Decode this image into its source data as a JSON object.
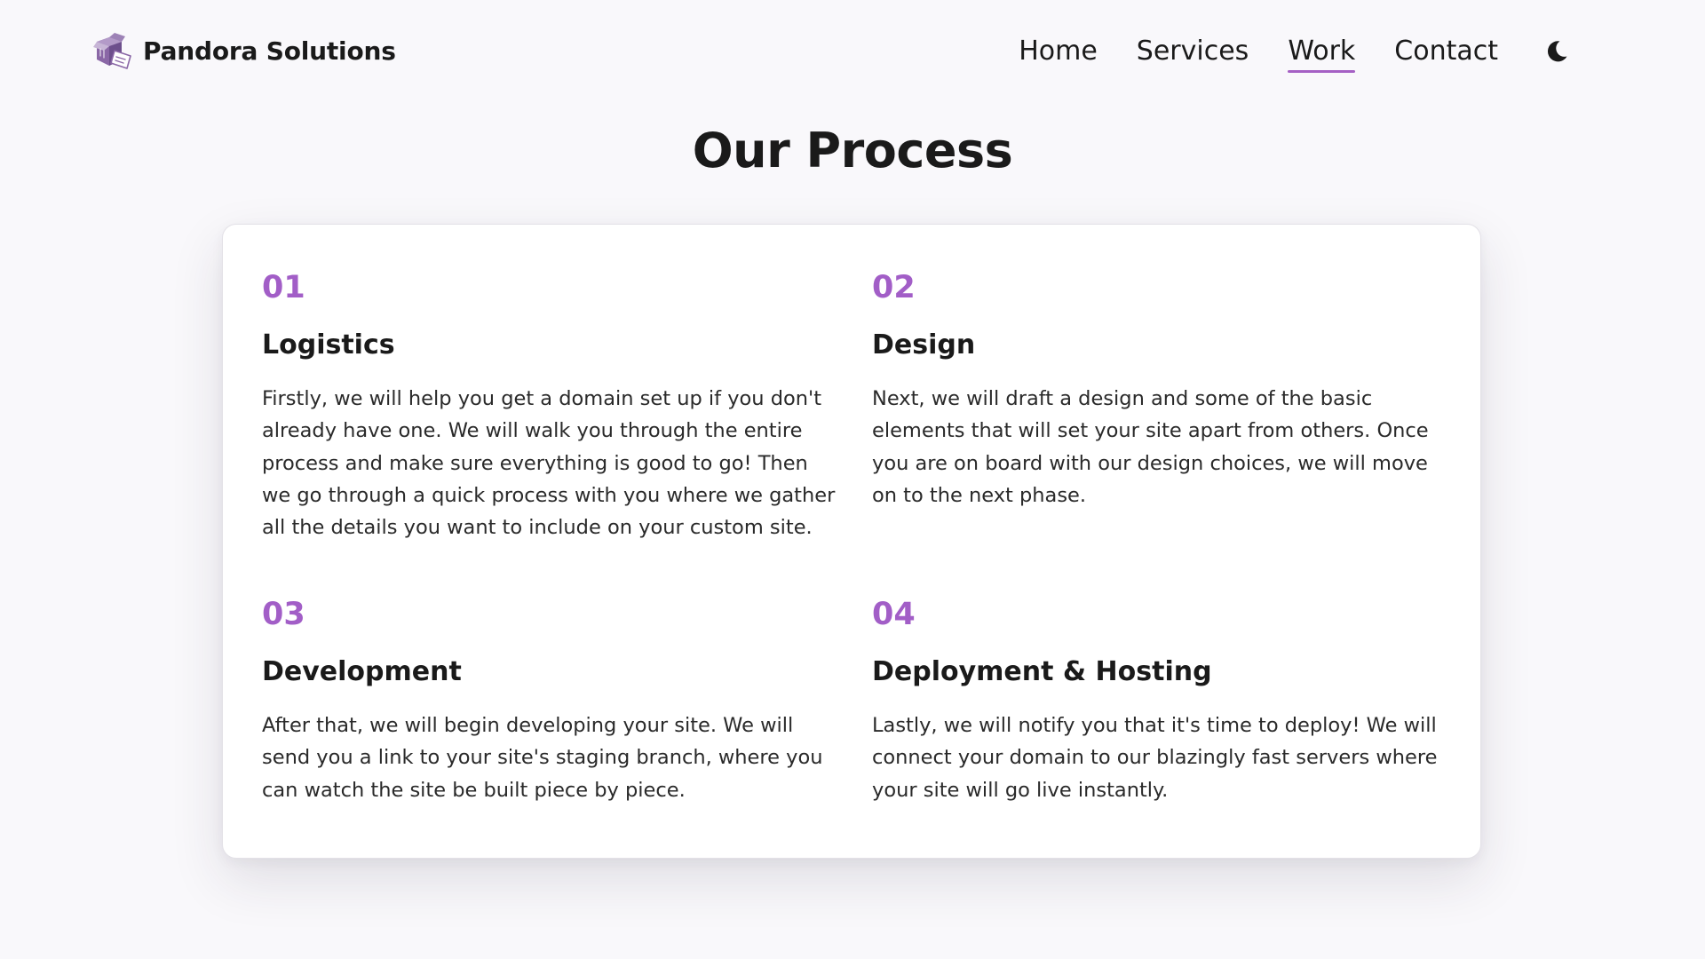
{
  "brand": {
    "name": "Pandora Solutions",
    "logo_icon": "open-box-logo-icon"
  },
  "nav": {
    "items": [
      {
        "label": "Home",
        "active": false
      },
      {
        "label": "Services",
        "active": false
      },
      {
        "label": "Work",
        "active": true
      },
      {
        "label": "Contact",
        "active": false
      }
    ],
    "theme_toggle_icon": "moon-icon"
  },
  "page": {
    "title": "Our Process"
  },
  "process": {
    "steps": [
      {
        "number": "01",
        "title": "Logistics",
        "description": "Firstly, we will help you get a domain set up if you don't already have one. We will walk you through the entire process and make sure everything is good to go! Then we go through a quick process with you where we gather all the details you want to include on your custom site."
      },
      {
        "number": "02",
        "title": "Design",
        "description": "Next, we will draft a design and some of the basic elements that will set your site apart from others. Once you are on board with our design choices, we will move on to the next phase."
      },
      {
        "number": "03",
        "title": "Development",
        "description": "After that, we will begin developing your site. We will send you a link to your site's staging branch, where you can watch the site be built piece by piece."
      },
      {
        "number": "04",
        "title": "Deployment & Hosting",
        "description": "Lastly, we will notify you that it's time to deploy! We will connect your domain to our blazingly fast servers where your site will go live instantly."
      }
    ]
  },
  "colors": {
    "accent": "#a25ec7",
    "background": "#f9f8fb",
    "card": "#ffffff",
    "text": "#1a1a1a"
  }
}
